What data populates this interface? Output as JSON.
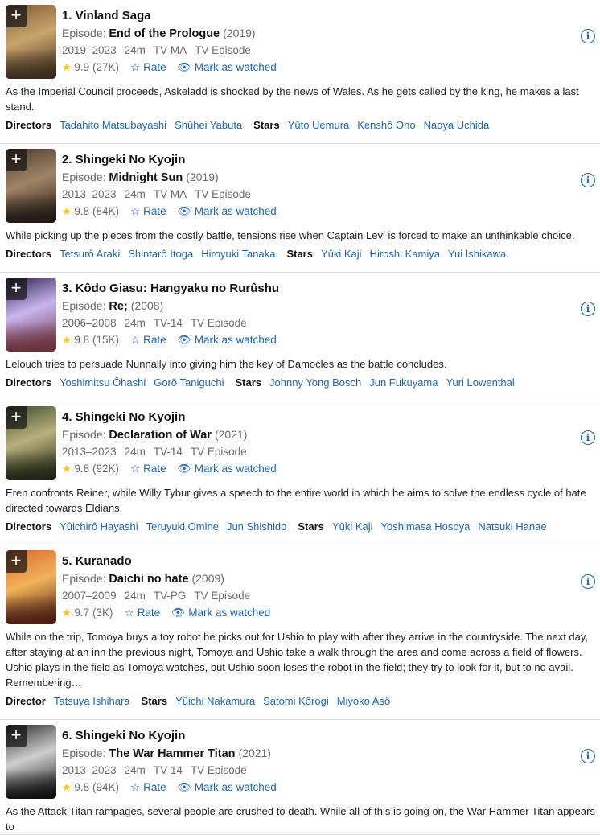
{
  "ui": {
    "plus": "+",
    "info": "i",
    "rate_icon": "☆",
    "watch_icon": "👁",
    "star_icon": "★",
    "episode_prefix": "Episode:"
  },
  "items": [
    {
      "title": "1. Vinland Saga",
      "episode": "End of the Prologue",
      "episode_year": "(2019)",
      "years": "2019–2023",
      "runtime": "24m",
      "rating_cert": "TV-MA",
      "type": "TV Episode",
      "score": "9.9",
      "votes": "(27K)",
      "rate_label": "Rate",
      "watch_label": "Mark as watched",
      "plot": "As the Imperial Council proceeds, Askeladd is shocked by the news of Wales. As he gets called by the king, he makes a last stand.",
      "directors_label": "Directors",
      "directors": [
        "Tadahito Matsubayashi",
        "Shûhei Yabuta"
      ],
      "stars_label": "Stars",
      "stars": [
        "Yûto Uemura",
        "Kenshô Ono",
        "Naoya Uchida"
      ],
      "poster_colors": [
        "#7a5a36",
        "#c9a56b",
        "#3a2b1c"
      ]
    },
    {
      "title": "2. Shingeki No Kyojin",
      "episode": "Midnight Sun",
      "episode_year": "(2019)",
      "years": "2013–2023",
      "runtime": "24m",
      "rating_cert": "TV-MA",
      "type": "TV Episode",
      "score": "9.8",
      "votes": "(84K)",
      "rate_label": "Rate",
      "watch_label": "Mark as watched",
      "plot": "While picking up the pieces from the costly battle, tensions rise when Captain Levi is forced to make an unthinkable choice.",
      "directors_label": "Directors",
      "directors": [
        "Tetsurô Araki",
        "Shintarô Itoga",
        "Hiroyuki Tanaka"
      ],
      "stars_label": "Stars",
      "stars": [
        "Yûki Kaji",
        "Hiroshi Kamiya",
        "Yui Ishikawa"
      ],
      "poster_colors": [
        "#4a3b2c",
        "#a08466",
        "#201812"
      ]
    },
    {
      "title": "3. Kôdo Giasu: Hangyaku no Rurûshu",
      "episode": "Re;",
      "episode_year": "(2008)",
      "years": "2006–2008",
      "runtime": "24m",
      "rating_cert": "TV-14",
      "type": "TV Episode",
      "score": "9.8",
      "votes": "(15K)",
      "rate_label": "Rate",
      "watch_label": "Mark as watched",
      "plot": "Lelouch tries to persuade Nunnally into giving him the key of Damocles as the battle concludes.",
      "directors_label": "Directors",
      "directors": [
        "Yoshimitsu Ôhashi",
        "Gorô Taniguchi"
      ],
      "stars_label": "Stars",
      "stars": [
        "Johnny Yong Bosch",
        "Jun Fukuyama",
        "Yuri Lowenthal"
      ],
      "poster_colors": [
        "#2a1f4a",
        "#c8b6f0",
        "#6a2f3a"
      ]
    },
    {
      "title": "4. Shingeki No Kyojin",
      "episode": "Declaration of War",
      "episode_year": "(2021)",
      "years": "2013–2023",
      "runtime": "24m",
      "rating_cert": "TV-14",
      "type": "TV Episode",
      "score": "9.8",
      "votes": "(92K)",
      "rate_label": "Rate",
      "watch_label": "Mark as watched",
      "plot": "Eren confronts Reiner, while Willy Tybur gives a speech to the entire world in which he aims to solve the endless cycle of hate directed towards Eldians.",
      "directors_label": "Directors",
      "directors": [
        "Yûichirô Hayashi",
        "Teruyuki Omine",
        "Jun Shishido"
      ],
      "stars_label": "Stars",
      "stars": [
        "Yûki Kaji",
        "Yoshimasa Hosoya",
        "Natsuki Hanae"
      ],
      "poster_colors": [
        "#3c4a2e",
        "#b9b07a",
        "#1e2414"
      ]
    },
    {
      "title": "5. Kuranado",
      "episode": "Daichi no hate",
      "episode_year": "(2009)",
      "years": "2007–2009",
      "runtime": "24m",
      "rating_cert": "TV-PG",
      "type": "TV Episode",
      "score": "9.7",
      "votes": "(3K)",
      "rate_label": "Rate",
      "watch_label": "Mark as watched",
      "plot": "While on the trip, Tomoya buys a toy robot he picks out for Ushio to play with after they arrive in the countryside. The next day, after staying at an inn the previous night, Tomoya and Ushio take a walk through the area and come across a field of flowers. Ushio plays in the field as Tomoya watches, but Ushio soon loses the robot in the field; they try to look for it, but to no avail. Remembering…",
      "directors_label": "Director",
      "directors": [
        "Tatsuya Ishihara"
      ],
      "stars_label": "Stars",
      "stars": [
        "Yûichi Nakamura",
        "Satomi Kôrogi",
        "Miyoko Asô"
      ],
      "poster_colors": [
        "#d9692b",
        "#f2b25a",
        "#4a1e12"
      ]
    },
    {
      "title": "6. Shingeki No Kyojin",
      "episode": "The War Hammer Titan",
      "episode_year": "(2021)",
      "years": "2013–2023",
      "runtime": "24m",
      "rating_cert": "TV-14",
      "type": "TV Episode",
      "score": "9.8",
      "votes": "(94K)",
      "rate_label": "Rate",
      "watch_label": "Mark as watched",
      "plot": "As the Attack Titan rampages, several people are crushed to death. While all of this is going on, the War Hammer Titan appears to",
      "directors_label": "",
      "directors": [],
      "stars_label": "",
      "stars": [],
      "poster_colors": [
        "#2b2b2b",
        "#cfcfcf",
        "#101010"
      ]
    }
  ]
}
